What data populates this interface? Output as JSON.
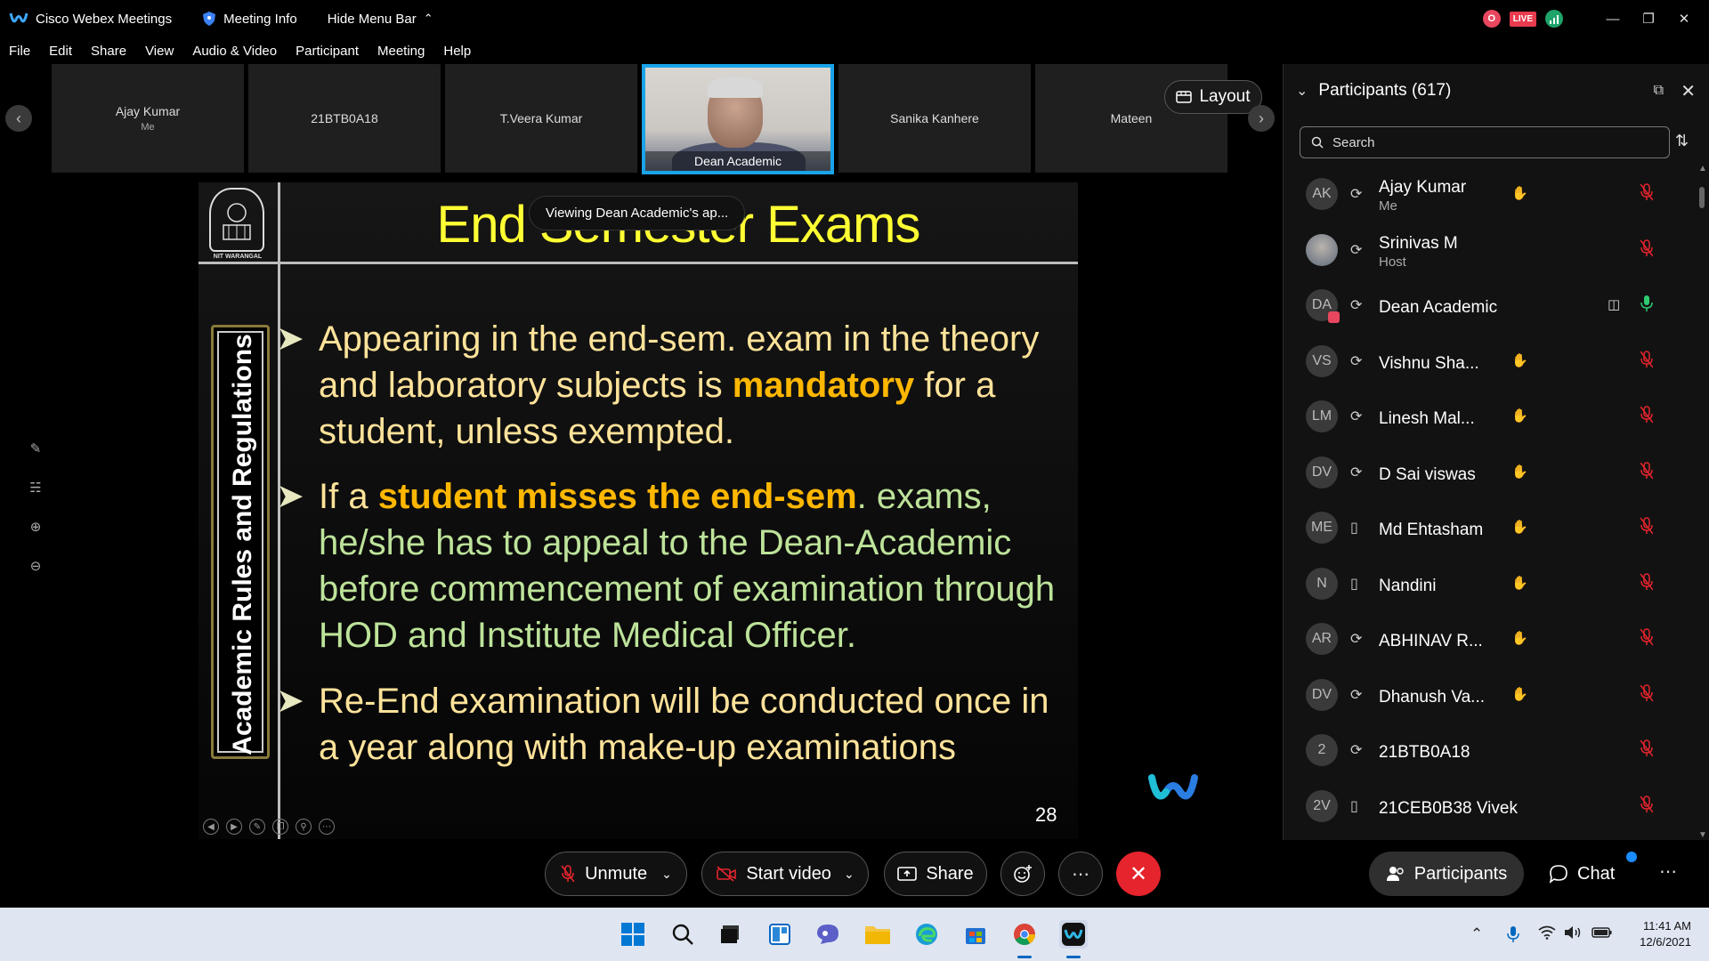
{
  "titlebar": {
    "app_title": "Cisco Webex Meetings",
    "meeting_info": "Meeting Info",
    "hide_menu": "Hide Menu Bar",
    "rec_letter": "O",
    "live": "LIVE"
  },
  "menu": [
    "File",
    "Edit",
    "Share",
    "View",
    "Audio & Video",
    "Participant",
    "Meeting",
    "Help"
  ],
  "filmstrip": {
    "tiles": [
      {
        "name": "Ajay Kumar",
        "sub": "Me"
      },
      {
        "name": "21BTB0A18",
        "sub": ""
      },
      {
        "name": "T.Veera Kumar",
        "sub": ""
      },
      {
        "name": "Dean Academic",
        "sub": ""
      },
      {
        "name": "Sanika Kanhere",
        "sub": ""
      },
      {
        "name": "Mateen",
        "sub": ""
      }
    ],
    "layout_label": "Layout"
  },
  "viewing_tip": "Viewing Dean Academic's ap...",
  "slide": {
    "logo_text": "NIT WARANGAL",
    "title": "End Semester Exams",
    "side_text": "Academic Rules and Regulations",
    "bullets": [
      {
        "pre": "Appearing in the end-sem. exam in the theory and laboratory subjects is ",
        "hl": "mandatory",
        "post": " for a student, unless exempted."
      },
      {
        "pre": "If a ",
        "hl": "student misses the end-sem",
        "post": ". exams, he/she has to appeal to the Dean-Academic before commencement of examination through HOD and Institute Medical Officer."
      },
      {
        "pre": "Re-End examination will be conducted once in a year along with make-up examinations",
        "hl": "",
        "post": ""
      }
    ],
    "page_number": "28"
  },
  "participants_panel": {
    "title": "Participants (617)",
    "search_placeholder": "Search",
    "rows": [
      {
        "initials": "AK",
        "name": "Ajay Kumar",
        "role": "Me",
        "device": "sync",
        "hand": true,
        "cam": false,
        "mic": "muted"
      },
      {
        "initials": "",
        "name": "Srinivas M",
        "role": "Host",
        "device": "sync",
        "hand": false,
        "cam": false,
        "mic": "muted",
        "photo": true
      },
      {
        "initials": "DA",
        "name": "Dean Academic",
        "role": "",
        "device": "sync",
        "hand": false,
        "cam": true,
        "mic": "active"
      },
      {
        "initials": "VS",
        "name": "Vishnu Sha...",
        "role": "",
        "device": "sync",
        "hand": true,
        "cam": false,
        "mic": "muted"
      },
      {
        "initials": "LM",
        "name": "Linesh Mal...",
        "role": "",
        "device": "sync",
        "hand": true,
        "cam": false,
        "mic": "muted"
      },
      {
        "initials": "DV",
        "name": "D Sai viswas",
        "role": "",
        "device": "sync",
        "hand": true,
        "cam": false,
        "mic": "muted"
      },
      {
        "initials": "ME",
        "name": "Md Ehtasham",
        "role": "",
        "device": "phone",
        "hand": true,
        "cam": false,
        "mic": "muted"
      },
      {
        "initials": "N",
        "name": "Nandini",
        "role": "",
        "device": "phone",
        "hand": true,
        "cam": false,
        "mic": "muted"
      },
      {
        "initials": "AR",
        "name": "ABHINAV R...",
        "role": "",
        "device": "sync",
        "hand": true,
        "cam": false,
        "mic": "muted"
      },
      {
        "initials": "DV",
        "name": "Dhanush Va...",
        "role": "",
        "device": "sync",
        "hand": true,
        "cam": false,
        "mic": "muted"
      },
      {
        "initials": "2",
        "name": "21BTB0A18",
        "role": "",
        "device": "sync",
        "hand": false,
        "cam": false,
        "mic": "muted"
      },
      {
        "initials": "2V",
        "name": "21CEB0B38 Vivek",
        "role": "",
        "device": "phone",
        "hand": false,
        "cam": false,
        "mic": "muted"
      }
    ]
  },
  "controls": {
    "unmute": "Unmute",
    "start_video": "Start video",
    "share": "Share",
    "participants": "Participants",
    "chat": "Chat"
  },
  "taskbar": {
    "time": "11:41 AM",
    "date": "12/6/2021"
  },
  "colors": {
    "accent": "#1aa3e8",
    "end_call": "#e5242d",
    "slide_title": "#ffff33",
    "highlight": "#ffb700"
  }
}
